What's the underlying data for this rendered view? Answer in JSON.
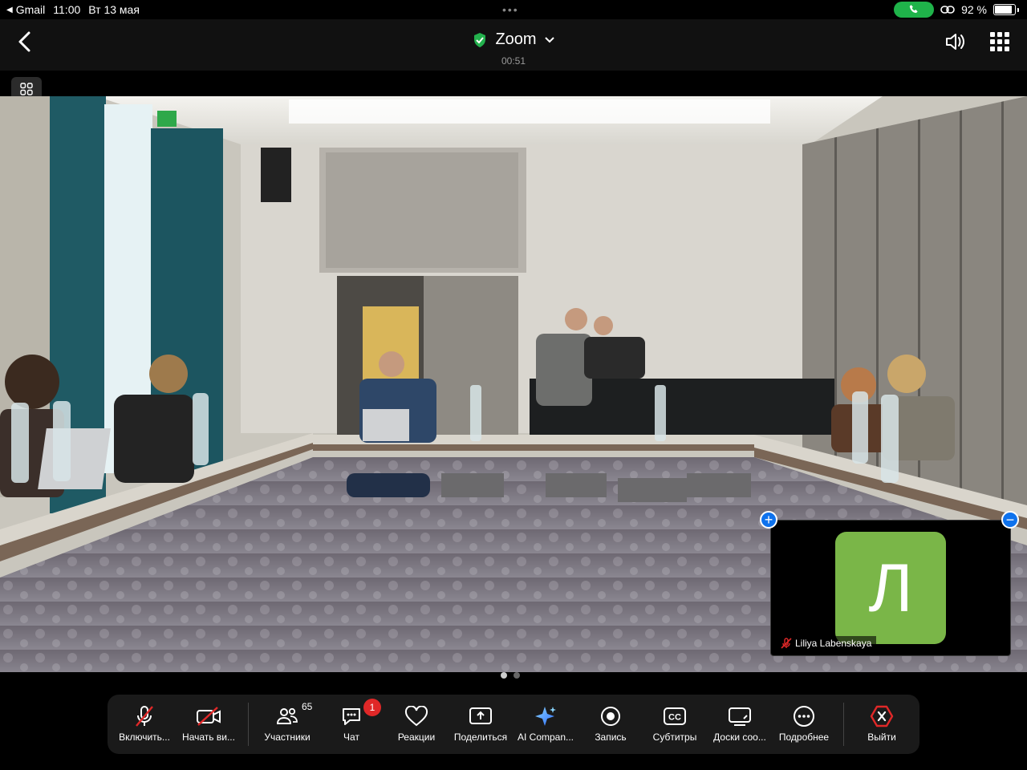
{
  "status_bar": {
    "back_app": "Gmail",
    "time": "11:00",
    "date": "Вт 13 мая",
    "battery": "92 %"
  },
  "header": {
    "title": "Zoom",
    "timer": "00:51"
  },
  "self_view": {
    "avatar_letter": "Л",
    "name": "Liliya Labenskaya"
  },
  "toolbar": {
    "mic_label": "Включить...",
    "video_label": "Начать ви...",
    "participants_label": "Участники",
    "participants_count": "65",
    "chat_label": "Чат",
    "chat_badge": "1",
    "reactions_label": "Реакции",
    "share_label": "Поделиться",
    "ai_label": "AI Compan...",
    "record_label": "Запись",
    "captions_label": "Субтитры",
    "whiteboards_label": "Доски соо...",
    "more_label": "Подробнее",
    "leave_label": "Выйти"
  },
  "colors": {
    "accent": "#0e72ed",
    "avatar": "#7ab648",
    "leave": "#e02828",
    "call_pill": "#1fb34a"
  }
}
